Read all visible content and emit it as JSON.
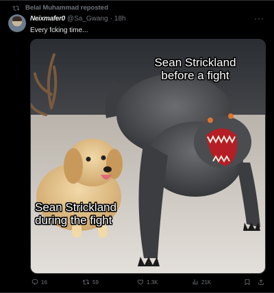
{
  "repost": {
    "text": "Belal Muhammad reposted",
    "icon": "repost-icon"
  },
  "author": {
    "display_name": "Neixmafer0",
    "handle": "@Sa_Gwang",
    "separator": "·",
    "time": "18h"
  },
  "more_icon": "more-icon",
  "tweet": {
    "text": "Every fcking time..."
  },
  "media": {
    "caption_top_line1": "Sean Strickland",
    "caption_top_line2": "before a fight",
    "caption_bottom_line1": "Sean Strickland",
    "caption_bottom_line2": "during the fight"
  },
  "actions": {
    "replies": "16",
    "reposts": "59",
    "likes": "1.3K",
    "views": "21K"
  },
  "colors": {
    "background": "#000000",
    "text": "#e7e9ea",
    "muted": "#71767b",
    "border": "#2f3336"
  }
}
